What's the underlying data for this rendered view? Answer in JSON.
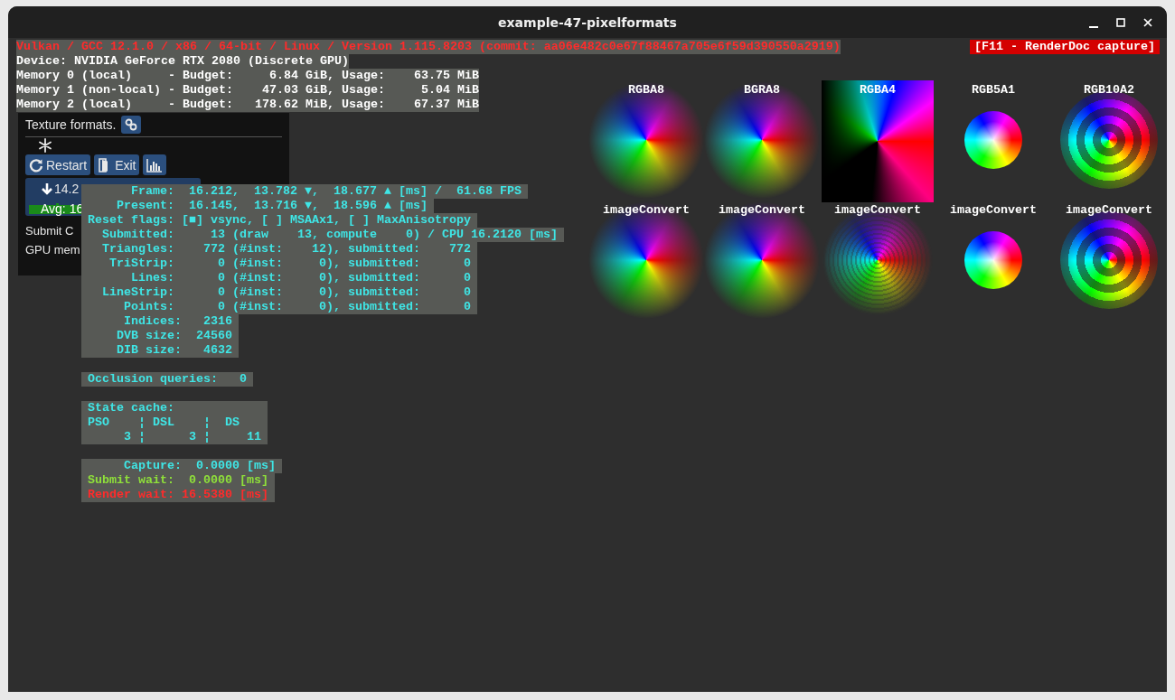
{
  "window": {
    "title": "example-47-pixelformats"
  },
  "header": {
    "badge": "[F11 - RenderDoc capture]",
    "lines": [
      {
        "text": "Vulkan / GCC 12.1.0 / x86 / 64-bit / Linux / Version 1.115.8203 (commit: aa06e482c0e67f88467a705e6f59d390550a2919)",
        "kind": "alert"
      },
      {
        "text": "Device: NVIDIA GeForce RTX 2080 (Discrete GPU)",
        "kind": "info"
      },
      {
        "text": "Memory 0 (local)     - Budget:     6.84 GiB, Usage:    63.75 MiB",
        "kind": "info"
      },
      {
        "text": "Memory 1 (non-local) - Budget:    47.03 GiB, Usage:     5.04 MiB",
        "kind": "info"
      },
      {
        "text": "Memory 2 (local)     - Budget:   178.62 MiB, Usage:    67.37 MiB",
        "kind": "info"
      }
    ]
  },
  "panel": {
    "title": "Texture formats.",
    "buttons": [
      "Restart",
      "Exit"
    ],
    "graph": {
      "value": "14.2",
      "average": "Avg: 16"
    },
    "rows": [
      "Submit C",
      "GPU mem"
    ]
  },
  "stats_blocks": [
    {
      "lines": [
        {
          "text": "      Frame:  16.212,  13.782 ▼,  18.677 ▲ [ms] /  61.68 FPS",
          "kind": "stat"
        },
        {
          "text": "    Present:  16.145,  13.716 ▼,  18.596 ▲ [ms]",
          "kind": "stat"
        },
        {
          "text": "Reset flags: [■] vsync, [ ] MSAAx1, [ ] MaxAnisotropy",
          "kind": "stat"
        },
        {
          "text": "  Submitted:     13 (draw    13, compute    0) / CPU 16.2120 [ms]",
          "kind": "stat"
        },
        {
          "text": "  Triangles:    772 (#inst:    12), submitted:    772",
          "kind": "stat"
        },
        {
          "text": "   TriStrip:      0 (#inst:     0), submitted:      0",
          "kind": "stat"
        },
        {
          "text": "      Lines:      0 (#inst:     0), submitted:      0",
          "kind": "stat"
        },
        {
          "text": "  LineStrip:      0 (#inst:     0), submitted:      0",
          "kind": "stat"
        },
        {
          "text": "     Points:      0 (#inst:     0), submitted:      0",
          "kind": "stat"
        },
        {
          "text": "     Indices:   2316",
          "kind": "stat"
        },
        {
          "text": "    DVB size:  24560",
          "kind": "stat"
        },
        {
          "text": "    DIB size:   4632",
          "kind": "stat"
        }
      ]
    },
    {
      "lines": [
        {
          "text": "Occlusion queries:   0",
          "kind": "stat"
        }
      ]
    },
    {
      "lines": [
        {
          "text": "State cache:            ",
          "kind": "stat"
        },
        {
          "text": "PSO    ¦ DSL    ¦  DS   ",
          "kind": "stat"
        },
        {
          "text": "     3 ¦      3 ¦     11",
          "kind": "stat"
        }
      ]
    },
    {
      "lines": [
        {
          "text": "     Capture:  0.0000 [ms]",
          "kind": "stat"
        },
        {
          "text": "Submit wait:  0.0000 [ms]",
          "kind": "ok"
        },
        {
          "text": "Render wait: 16.5380 [ms]",
          "kind": "alert"
        }
      ]
    }
  ],
  "textures": [
    {
      "label": "RGBA8",
      "kind": "soft"
    },
    {
      "label": "BGRA8",
      "kind": "soft"
    },
    {
      "label": "RGBA4",
      "kind": "square"
    },
    {
      "label": "RGB5A1",
      "kind": "disc"
    },
    {
      "label": "RGB10A2",
      "kind": "rings"
    },
    {
      "label": "imageConvert",
      "kind": "soft"
    },
    {
      "label": "imageConvert",
      "kind": "soft"
    },
    {
      "label": "imageConvert",
      "kind": "banded"
    },
    {
      "label": "imageConvert",
      "kind": "disc"
    },
    {
      "label": "imageConvert",
      "kind": "rings"
    }
  ]
}
